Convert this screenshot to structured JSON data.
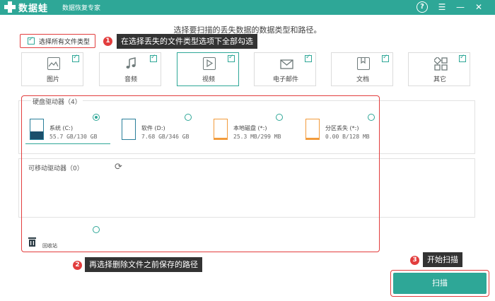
{
  "app": {
    "brand": "数据蛙",
    "subtitle": "数据恢复专家",
    "help_icon": "help-circle-icon",
    "menu_icon": "menu-icon",
    "min_icon": "minimize-icon",
    "close_icon": "close-icon",
    "accent": "#2ea797",
    "highlight": "#e23d3d"
  },
  "prompt": "选择要扫描的丢失数据的数据类型和路径。",
  "select_all": {
    "label": "选择所有文件类型",
    "checked": true
  },
  "callouts": {
    "c1": {
      "num": "1",
      "text": "在选择丢失的文件类型选项下全部勾选"
    },
    "c2": {
      "num": "2",
      "text": "再选择删除文件之前保存的路径"
    },
    "c3": {
      "num": "3",
      "text": "开始扫描"
    }
  },
  "file_types": [
    {
      "label": "图片",
      "icon": "image-icon",
      "checked": true
    },
    {
      "label": "音频",
      "icon": "music-icon",
      "checked": true
    },
    {
      "label": "视频",
      "icon": "video-icon",
      "checked": true,
      "selected": true
    },
    {
      "label": "电子邮件",
      "icon": "email-icon",
      "checked": true
    },
    {
      "label": "文档",
      "icon": "document-icon",
      "checked": true
    },
    {
      "label": "其它",
      "icon": "other-icon",
      "checked": true
    }
  ],
  "hard_drives": {
    "title": "硬盘驱动器（4）",
    "items": [
      {
        "name": "系统 (C:)",
        "size": "55.7 GB/130 GB",
        "selected": true
      },
      {
        "name": "软件 (D:)",
        "size": "7.68 GB/346 GB",
        "selected": false
      },
      {
        "name": "本地磁盘 (*:)",
        "size": "25.3 MB/299 MB",
        "selected": false
      },
      {
        "name": "分区丢失 (*:)",
        "size": "0.00  B/128 MB",
        "selected": false
      }
    ]
  },
  "removable": {
    "title": "可移动驱动器（0）",
    "refresh_icon": "refresh-icon"
  },
  "recycle_bin": {
    "label": "回收站",
    "icon": "trash-icon"
  },
  "scan_button": "扫描"
}
